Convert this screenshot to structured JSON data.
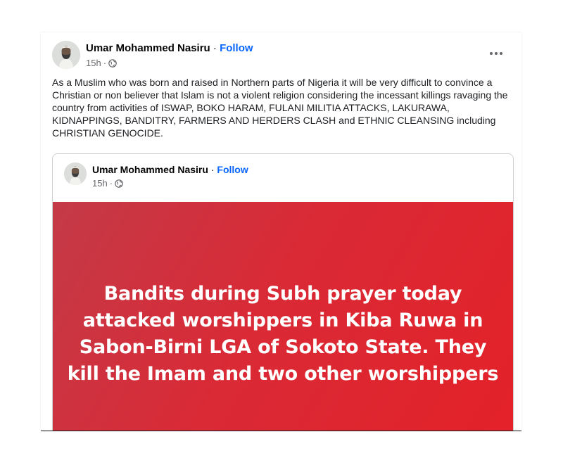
{
  "post": {
    "author": "Umar Mohammed Nasiru",
    "separator": "·",
    "follow": "Follow",
    "time": "15h",
    "time_separator": "·",
    "text": "As a Muslim who was born and raised in Northern parts of Nigeria it will be very difficult to convince a Christian or non believer that Islam is not a violent religion considering the incessant killings ravaging the country from activities of ISWAP, BOKO HARAM, FULANI MILITIA ATTACKS, LAKURAWA, KIDNAPPINGS, BANDITRY, FARMERS AND HERDERS CLASH and ETHNIC CLEANSING including CHRISTIAN GENOCIDE.",
    "more_icon": "three-dots-icon",
    "privacy_icon": "globe-icon"
  },
  "shared": {
    "author": "Umar Mohammed Nasiru",
    "separator": "·",
    "follow": "Follow",
    "time": "15h",
    "time_separator": "·",
    "banner_text": "Bandits during Subh prayer today attacked worshippers in Kiba Ruwa in Sabon-Birni LGA of Sokoto State. They kill the Imam and two other worshippers",
    "banner_color": "#d92a36"
  },
  "colors": {
    "link": "#0866ff",
    "secondary_text": "#65676b"
  }
}
